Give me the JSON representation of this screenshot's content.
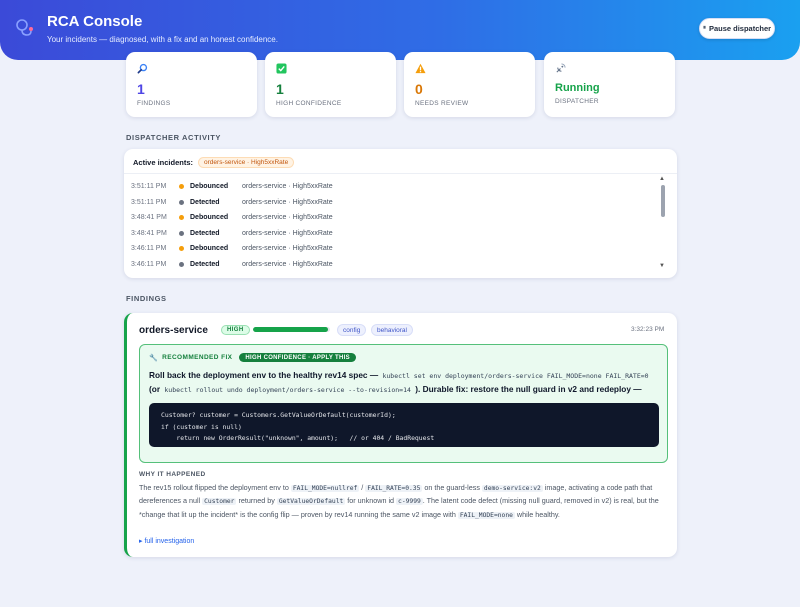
{
  "header": {
    "title": "RCA Console",
    "subtitle": "Your incidents — diagnosed, with a fix and an honest confidence.",
    "pause_button": "Pause dispatcher",
    "pause_icon": "⏸"
  },
  "stats": [
    {
      "value": "1",
      "label": "FINDINGS",
      "icon": "magnifier-icon",
      "color": "#4f46e5"
    },
    {
      "value": "1",
      "label": "HIGH CONFIDENCE",
      "icon": "check-box-icon",
      "color": "#15803d"
    },
    {
      "value": "0",
      "label": "NEEDS REVIEW",
      "icon": "warning-icon",
      "color": "#d97706"
    },
    {
      "value": "Running",
      "label": "DISPATCHER",
      "icon": "satellite-icon",
      "color": "#16a34a"
    }
  ],
  "activity": {
    "section_label": "DISPATCHER ACTIVITY",
    "active_label": "Active incidents:",
    "active_pill": "orders-service · High5xxRate",
    "rows": [
      {
        "time": "3:51:11 PM",
        "event": "Debounced",
        "desc": "orders-service · High5xxRate",
        "dot": "#f59e0b"
      },
      {
        "time": "3:51:11 PM",
        "event": "Detected",
        "desc": "orders-service · High5xxRate",
        "dot": "#6b7280"
      },
      {
        "time": "3:48:41 PM",
        "event": "Debounced",
        "desc": "orders-service · High5xxRate",
        "dot": "#f59e0b"
      },
      {
        "time": "3:48:41 PM",
        "event": "Detected",
        "desc": "orders-service · High5xxRate",
        "dot": "#6b7280"
      },
      {
        "time": "3:46:11 PM",
        "event": "Debounced",
        "desc": "orders-service · High5xxRate",
        "dot": "#f59e0b"
      },
      {
        "time": "3:46:11 PM",
        "event": "Detected",
        "desc": "orders-service · High5xxRate",
        "dot": "#6b7280"
      }
    ]
  },
  "findings": {
    "section_label": "FINDINGS",
    "service": "orders-service",
    "badge": "HIGH",
    "confidence": 0.97,
    "tags": [
      "config",
      "behavioral"
    ],
    "timestamp": "3:32:23 PM",
    "fix": {
      "head": "RECOMMENDED FIX",
      "pill": "HIGH CONFIDENCE · APPLY THIS",
      "text_a": "Roll back the deployment env to the healthy rev14 spec — ",
      "code_a": "kubectl set env deployment/orders-service FAIL_MODE=none FAIL_RATE=0",
      "text_b": " (or ",
      "code_b": "kubectl rollout undo deployment/orders-service --to-revision=14",
      "text_c": " ). Durable fix: restore the null guard in v2 and redeploy —",
      "code": "Customer? customer = Customers.GetValueOrDefault(customerId);\nif (customer is null)\n    return new OrderResult(\"unknown\", amount);   // or 404 / BadRequest"
    },
    "why": {
      "label": "WHY IT HAPPENED",
      "t1": "The rev15 rollout flipped the deployment env to ",
      "c1": "FAIL_MODE=nullref",
      "t2": " / ",
      "c2": "FAIL_RATE=0.35",
      "t3": " on the guard-less ",
      "c3": "demo-service:v2",
      "t4": " image, activating a code path that dereferences a null ",
      "c4": "Customer",
      "t5": " returned by ",
      "c5": "GetValueOrDefault",
      "t6": " for unknown id ",
      "c6": "c-9999",
      "t7": ". The latent code defect (missing null guard, removed in v2) is real, but the *change that lit up the incident* is the config flip — proven by rev14 running the same v2 image with ",
      "c7": "FAIL_MODE=none",
      "t8": " while healthy."
    },
    "full_investigation": "▸ full investigation"
  }
}
